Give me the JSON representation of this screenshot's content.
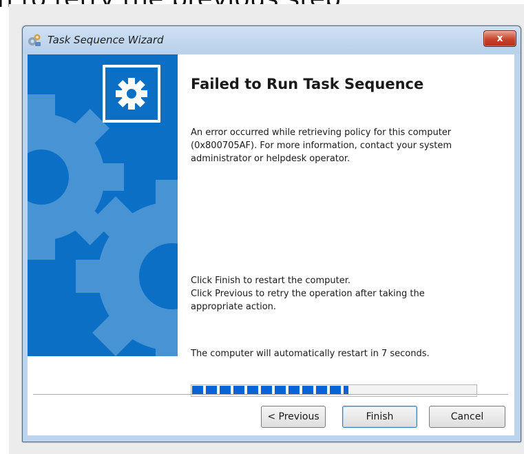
{
  "background_text": "n to retry the previous step",
  "window": {
    "title": "Task Sequence Wizard",
    "close_label": "x",
    "icons": {
      "app": "wizard-app-icon",
      "banner": "gear-icon",
      "close": "close-icon"
    }
  },
  "content": {
    "heading": "Failed to Run Task Sequence",
    "error_lines": [
      "An error occurred while retrieving policy for this computer",
      "(0x800705AF). For more information, contact your system",
      "administrator or helpdesk operator."
    ],
    "instruction_lines": [
      "Click Finish to restart the computer.",
      "Click Previous to retry the operation after taking the",
      "appropriate action."
    ],
    "countdown": "The computer will automatically restart in 7 seconds.",
    "progress_fraction": 0.55
  },
  "buttons": {
    "previous": "< Previous",
    "finish": "Finish",
    "cancel": "Cancel"
  },
  "colors": {
    "banner": "#0B6FC6",
    "progress": "#0A63D6",
    "close_button": "#C7432D"
  }
}
